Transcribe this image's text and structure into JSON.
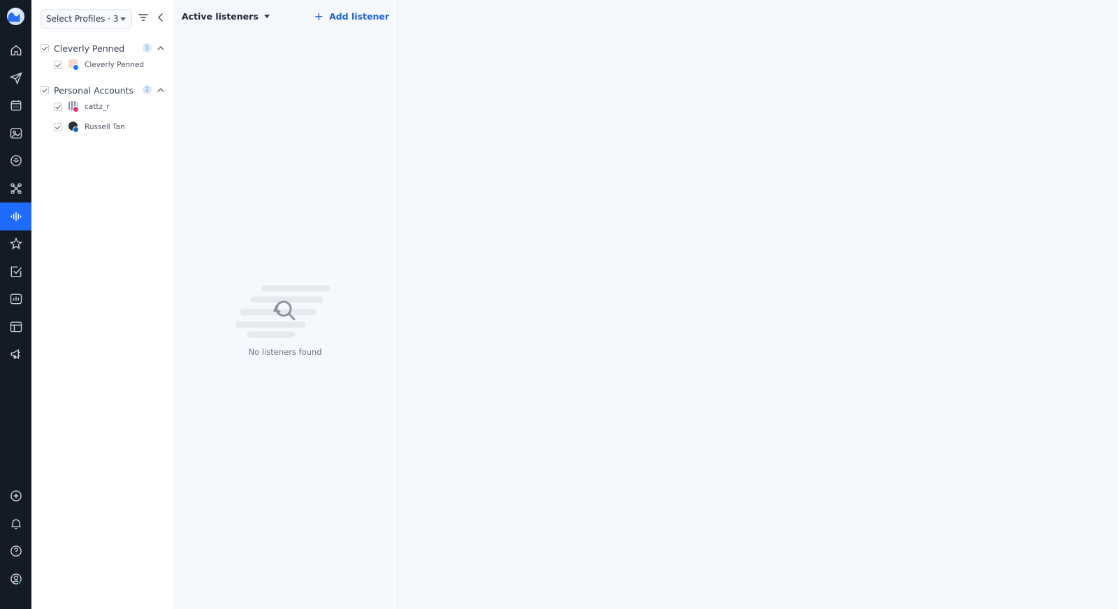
{
  "nav": {
    "items": [
      {
        "name": "home-icon",
        "active": false
      },
      {
        "name": "send-icon",
        "active": false
      },
      {
        "name": "calendar-icon",
        "active": false
      },
      {
        "name": "media-library-icon",
        "active": false
      },
      {
        "name": "inbox-icon",
        "active": false
      },
      {
        "name": "integrations-icon",
        "active": false
      },
      {
        "name": "listening-icon",
        "active": true
      },
      {
        "name": "star-icon",
        "active": false
      },
      {
        "name": "tasks-icon",
        "active": false
      },
      {
        "name": "analytics-icon",
        "active": false
      },
      {
        "name": "layout-icon",
        "active": false
      },
      {
        "name": "megaphone-icon",
        "active": false
      }
    ],
    "bottom_items": [
      {
        "name": "add-circle-icon"
      },
      {
        "name": "bell-icon"
      },
      {
        "name": "help-icon"
      },
      {
        "name": "user-account-icon"
      }
    ],
    "accent_color": "#1f6bff"
  },
  "profiles": {
    "selector_label": "Select Profiles · 3",
    "groups": [
      {
        "label": "Cleverly Penned",
        "count": "1",
        "checked": true,
        "accounts": [
          {
            "label": "Cleverly Penned",
            "network": "facebook",
            "checked": true
          }
        ]
      },
      {
        "label": "Personal Accounts",
        "count": "2",
        "checked": true,
        "accounts": [
          {
            "label": "cattz_r",
            "network": "instagram",
            "checked": true
          },
          {
            "label": "Russell Tan",
            "network": "linkedin",
            "checked": true
          }
        ]
      }
    ]
  },
  "listeners": {
    "title": "Active listeners",
    "add_label": "Add listener",
    "empty_text": "No listeners found"
  }
}
